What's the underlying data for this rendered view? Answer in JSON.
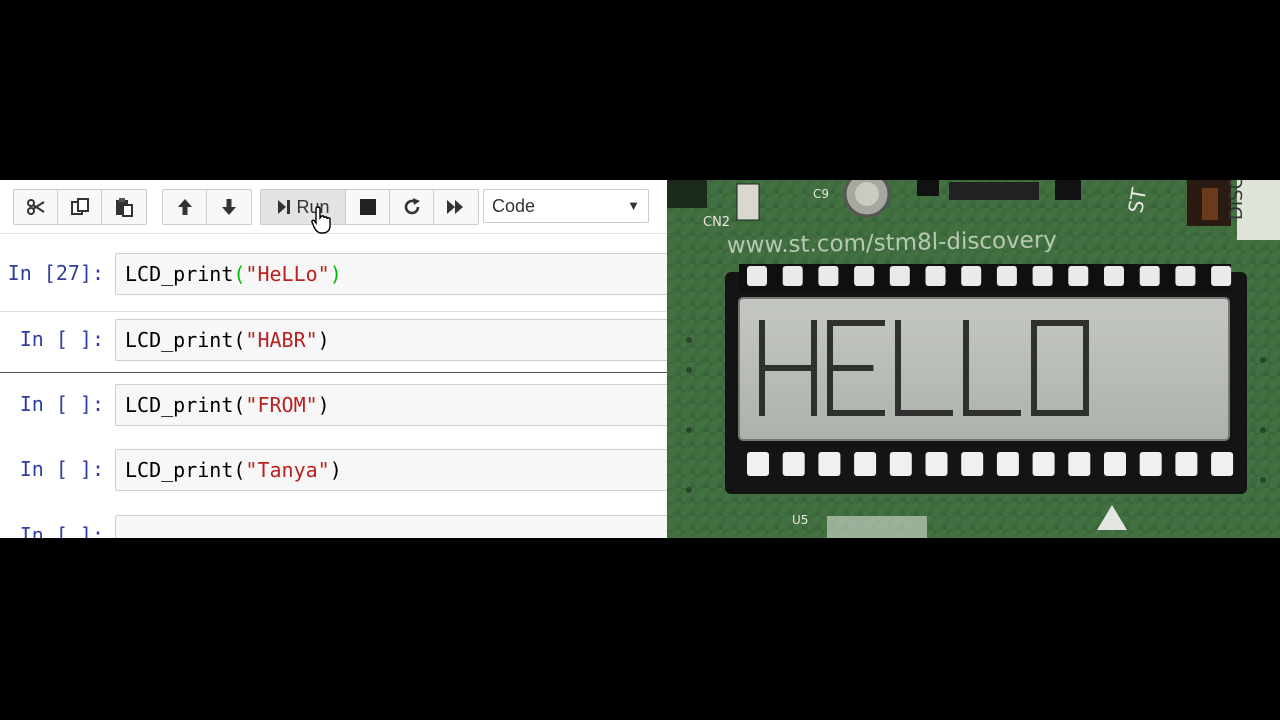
{
  "toolbar": {
    "run_label": "Run",
    "cell_type": "Code",
    "icons": [
      "cut-icon",
      "copy-icon",
      "paste-icon",
      "move-up-icon",
      "move-down-icon",
      "run-icon",
      "stop-icon",
      "restart-icon",
      "run-all-icon"
    ]
  },
  "cells": [
    {
      "prompt": "In [27]:",
      "func": "LCD_print",
      "arg": "\"HeLLo\""
    },
    {
      "prompt": "In [ ]:",
      "func": "LCD_print",
      "arg": "\"HABR\""
    },
    {
      "prompt": "In [ ]:",
      "func": "LCD_print",
      "arg": "\"FROM\""
    },
    {
      "prompt": "In [ ]:",
      "func": "LCD_print",
      "arg": "\"Tanya\""
    },
    {
      "prompt": "In [ ]:",
      "func": "",
      "arg": ""
    }
  ],
  "board": {
    "lcd_text": "HELLO",
    "silkscreen_url": "www.st.com/stm8l-discovery",
    "labels": [
      "CN2",
      "C9",
      "U5",
      "ST",
      "DISCO"
    ],
    "colors": {
      "pcb": "#3f6b3c",
      "lcd": "#b9bdb7",
      "segment": "#2e312e"
    }
  }
}
